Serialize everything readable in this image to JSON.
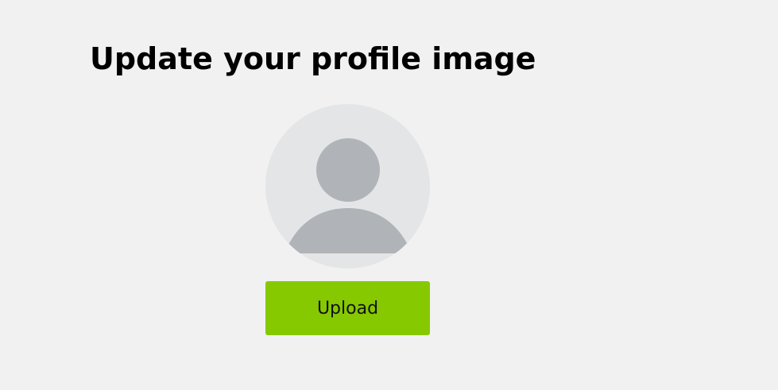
{
  "page": {
    "title": "Update your profile image"
  },
  "avatar": {
    "icon": "user-placeholder-icon",
    "background_color": "#e4e5e6",
    "figure_color": "#b0b4b8"
  },
  "upload": {
    "label": "Upload",
    "color": "#86c900"
  }
}
